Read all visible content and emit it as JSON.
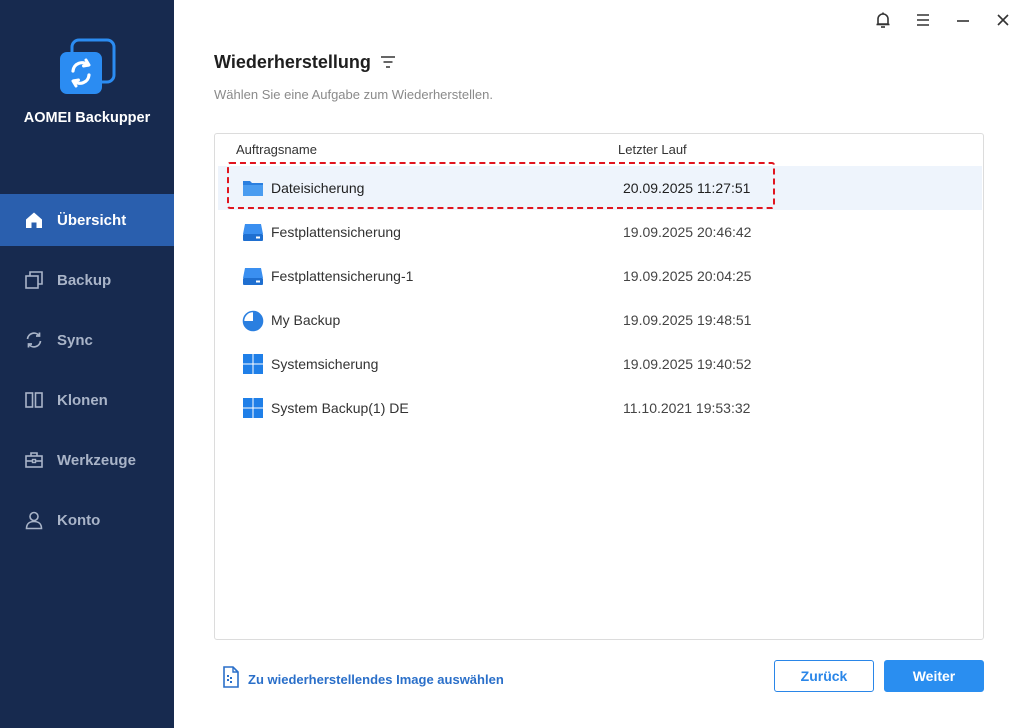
{
  "app": {
    "name": "AOMEI Backupper"
  },
  "sidebar": {
    "items": [
      {
        "label": "Übersicht",
        "icon": "home-icon",
        "active": true
      },
      {
        "label": "Backup",
        "icon": "backup-icon",
        "active": false
      },
      {
        "label": "Sync",
        "icon": "sync-icon",
        "active": false
      },
      {
        "label": "Klonen",
        "icon": "clone-icon",
        "active": false
      },
      {
        "label": "Werkzeuge",
        "icon": "toolbox-icon",
        "active": false
      },
      {
        "label": "Konto",
        "icon": "user-icon",
        "active": false
      }
    ]
  },
  "window_controls": [
    "bell-icon",
    "menu-icon",
    "minimize-icon",
    "close-icon"
  ],
  "main": {
    "title": "Wiederherstellung",
    "subtitle": "Wählen Sie eine Aufgabe zum Wiederherstellen.",
    "table": {
      "columns": [
        "Auftragsname",
        "Letzter Lauf"
      ],
      "rows": [
        {
          "name": "Dateisicherung",
          "date": "20.09.2025 11:27:51",
          "icon": "folder-icon",
          "selected": true
        },
        {
          "name": "Festplattensicherung",
          "date": "19.09.2025 20:46:42",
          "icon": "disk-icon",
          "selected": false
        },
        {
          "name": "Festplattensicherung-1",
          "date": "19.09.2025 20:04:25",
          "icon": "disk-icon",
          "selected": false
        },
        {
          "name": "My Backup",
          "date": "19.09.2025 19:48:51",
          "icon": "partition-icon",
          "selected": false
        },
        {
          "name": "Systemsicherung",
          "date": "19.09.2025 19:40:52",
          "icon": "windows-icon",
          "selected": false
        },
        {
          "name": "System Backup(1) DE",
          "date": "11.10.2021 19:53:32",
          "icon": "windows-icon",
          "selected": false
        }
      ]
    },
    "image_link": "Zu wiederherstellendes Image auswählen",
    "back_button": "Zurück",
    "next_button": "Weiter"
  },
  "colors": {
    "sidebar_bg": "#172a4f",
    "sidebar_active": "#2a5fae",
    "accent": "#2a8ef0",
    "highlight_border": "#e0141e"
  }
}
